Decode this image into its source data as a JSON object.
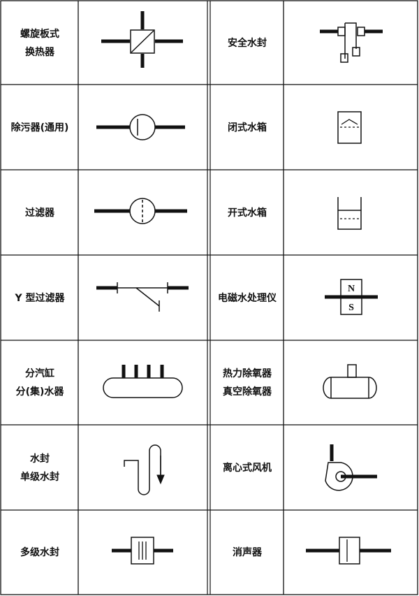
{
  "left_column": [
    {
      "lines": [
        "螺旋板式",
        "换热器"
      ],
      "icon": "spiral-plate-heat-exchanger-icon"
    },
    {
      "lines": [
        "除污器(通用)"
      ],
      "icon": "dirt-separator-icon"
    },
    {
      "lines": [
        "过滤器"
      ],
      "icon": "filter-icon"
    },
    {
      "lines": [
        "Y 型过滤器"
      ],
      "icon": "y-strainer-icon"
    },
    {
      "lines": [
        "分汽缸",
        "分(集)水器"
      ],
      "icon": "steam-header-icon"
    },
    {
      "lines": [
        "水封",
        "单级水封"
      ],
      "icon": "single-water-seal-icon"
    },
    {
      "lines": [
        "多级水封"
      ],
      "icon": "multi-stage-water-seal-icon"
    }
  ],
  "right_column": [
    {
      "lines": [
        "安全水封"
      ],
      "icon": "safety-water-seal-icon"
    },
    {
      "lines": [
        "闭式水箱"
      ],
      "icon": "closed-water-tank-icon"
    },
    {
      "lines": [
        "开式水箱"
      ],
      "icon": "open-water-tank-icon"
    },
    {
      "lines": [
        "电磁水处理仪"
      ],
      "icon": "electromagnetic-water-treatment-icon"
    },
    {
      "lines": [
        "热力除氧器",
        "真空除氧器"
      ],
      "icon": "deaerator-icon"
    },
    {
      "lines": [
        "离心式风机"
      ],
      "icon": "centrifugal-fan-icon"
    },
    {
      "lines": [
        "消声器"
      ],
      "icon": "silencer-icon"
    }
  ],
  "magnet_labels": {
    "north": "N",
    "south": "S"
  }
}
